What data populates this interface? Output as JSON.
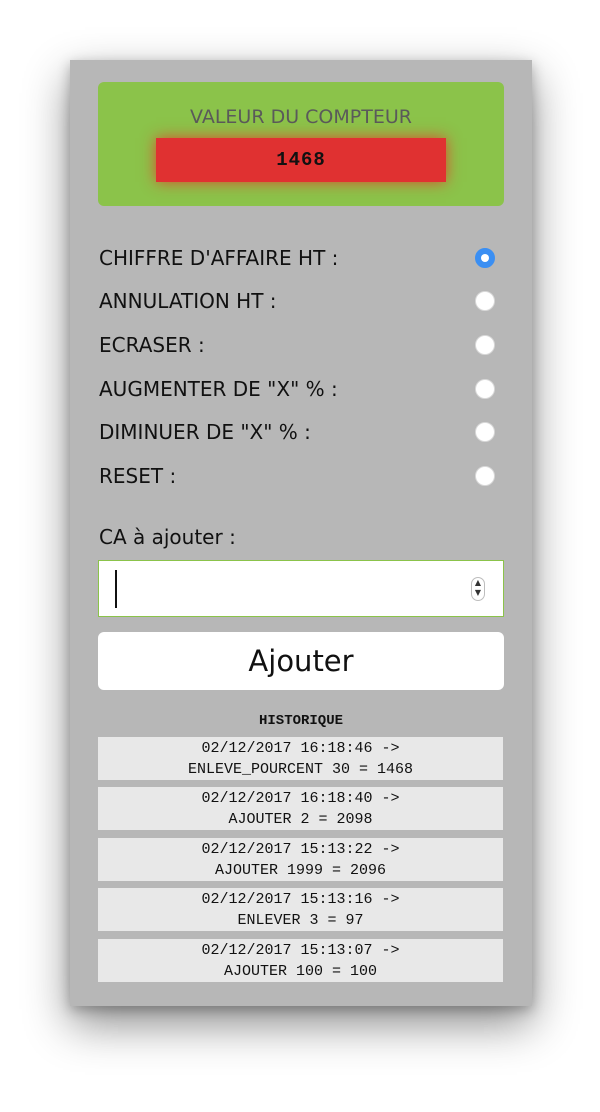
{
  "counter": {
    "title": "VALEUR DU COMPTEUR",
    "value": "1468"
  },
  "options": [
    {
      "label": "CHIFFRE D'AFFAIRE HT :",
      "checked": true
    },
    {
      "label": "ANNULATION HT :",
      "checked": false
    },
    {
      "label": "ECRASER :",
      "checked": false
    },
    {
      "label": "AUGMENTER DE \"X\" % :",
      "checked": false
    },
    {
      "label": "DIMINUER DE \"X\" % :",
      "checked": false
    },
    {
      "label": "RESET :",
      "checked": false
    }
  ],
  "input": {
    "label": "CA à ajouter :",
    "value": ""
  },
  "submit_label": "Ajouter",
  "history": {
    "title": "HISTORIQUE",
    "items": [
      {
        "line1": "02/12/2017 16:18:46 ->",
        "line2": "ENLEVE_POURCENT 30 = 1468"
      },
      {
        "line1": "02/12/2017 16:18:40 ->",
        "line2": "AJOUTER 2 = 2098"
      },
      {
        "line1": "02/12/2017 15:13:22 ->",
        "line2": "AJOUTER 1999 = 2096"
      },
      {
        "line1": "02/12/2017 15:13:16 ->",
        "line2": "ENLEVER 3 = 97"
      },
      {
        "line1": "02/12/2017 15:13:07 ->",
        "line2": "AJOUTER 100 = 100"
      }
    ]
  },
  "colors": {
    "panel_bg": "#b7b7b7",
    "counter_bg": "#8bc34a",
    "counter_value_bg": "#e03131",
    "radio_checked": "#3b8ff3"
  },
  "icons": {
    "stepper": "number-stepper-icon"
  }
}
